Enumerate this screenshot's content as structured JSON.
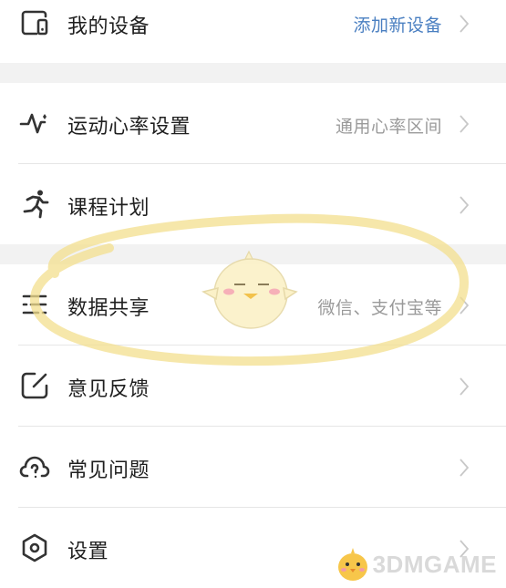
{
  "rows": [
    {
      "id": "my-device",
      "label": "我的设备",
      "value": "添加新设备",
      "value_is_link": true,
      "icon": "device-icon"
    },
    {
      "id": "hr-settings",
      "label": "运动心率设置",
      "value": "通用心率区间",
      "value_is_link": false,
      "icon": "heart-rate-icon"
    },
    {
      "id": "course-plan",
      "label": "课程计划",
      "value": "",
      "value_is_link": false,
      "icon": "running-icon"
    },
    {
      "id": "data-share",
      "label": "数据共享",
      "value": "微信、支付宝等",
      "value_is_link": false,
      "icon": "sliders-icon"
    },
    {
      "id": "feedback",
      "label": "意见反馈",
      "value": "",
      "value_is_link": false,
      "icon": "edit-icon"
    },
    {
      "id": "faq",
      "label": "常见问题",
      "value": "",
      "value_is_link": false,
      "icon": "question-cloud-icon"
    },
    {
      "id": "settings",
      "label": "设置",
      "value": "",
      "value_is_link": false,
      "icon": "hexagon-gear-icon"
    }
  ],
  "colors": {
    "link": "#4a7fc1",
    "highlight": "#f3df8e",
    "gap": "#f2f2f2"
  },
  "watermark": {
    "text": "3DMGAME"
  }
}
